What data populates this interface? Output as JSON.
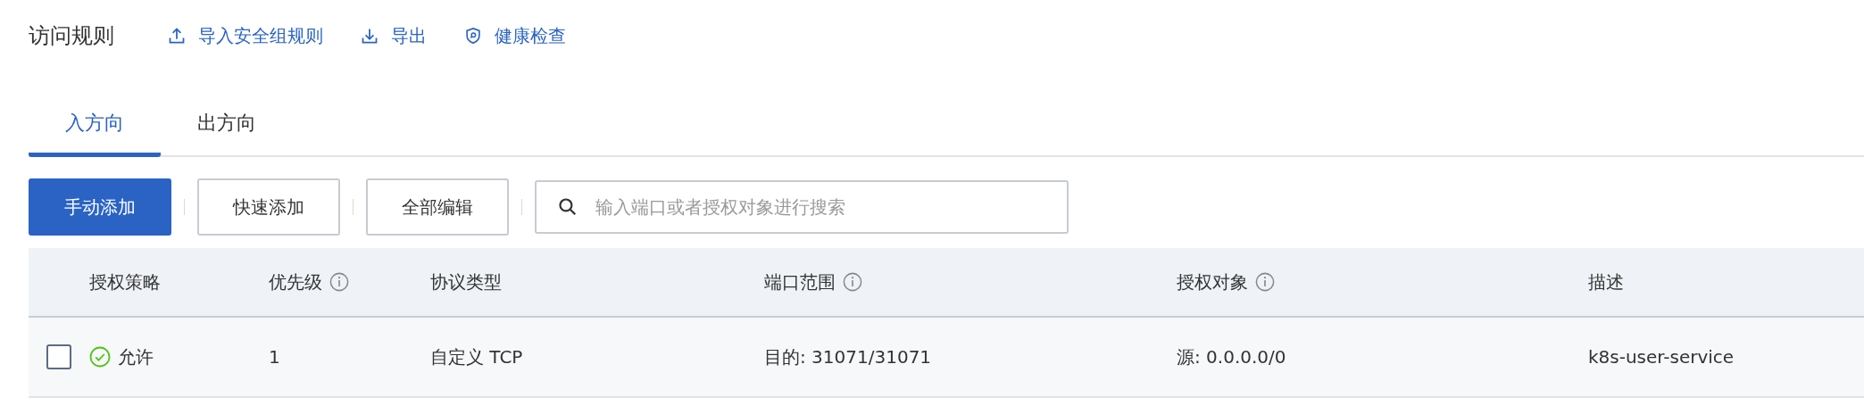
{
  "header": {
    "title": "访问规则",
    "actions": [
      {
        "kind": "import",
        "label": "导入安全组规则"
      },
      {
        "kind": "export",
        "label": "导出"
      },
      {
        "kind": "health",
        "label": "健康检查"
      }
    ]
  },
  "tabs": [
    {
      "label": "入方向",
      "selected": true
    },
    {
      "label": "出方向",
      "selected": false
    }
  ],
  "toolbar": {
    "buttons": [
      {
        "label": "手动添加",
        "primary": true
      },
      {
        "label": "快速添加",
        "primary": false
      },
      {
        "label": "全部编辑",
        "primary": false
      }
    ],
    "search": {
      "placeholder": "输入端口或者授权对象进行搜索"
    }
  },
  "table": {
    "columns": [
      {
        "label": "授权策略",
        "info": false
      },
      {
        "label": "优先级",
        "info": true
      },
      {
        "label": "协议类型",
        "info": false
      },
      {
        "label": "端口范围",
        "info": true
      },
      {
        "label": "授权对象",
        "info": true
      },
      {
        "label": "描述",
        "info": false
      }
    ],
    "rows": [
      {
        "checked": false,
        "policy": "允许",
        "allowed": true,
        "priority": "1",
        "protocol": "自定义 TCP",
        "ports": "目的: 31071/31071",
        "target": "源: 0.0.0.0/0",
        "description": "k8s-user-service"
      }
    ]
  }
}
